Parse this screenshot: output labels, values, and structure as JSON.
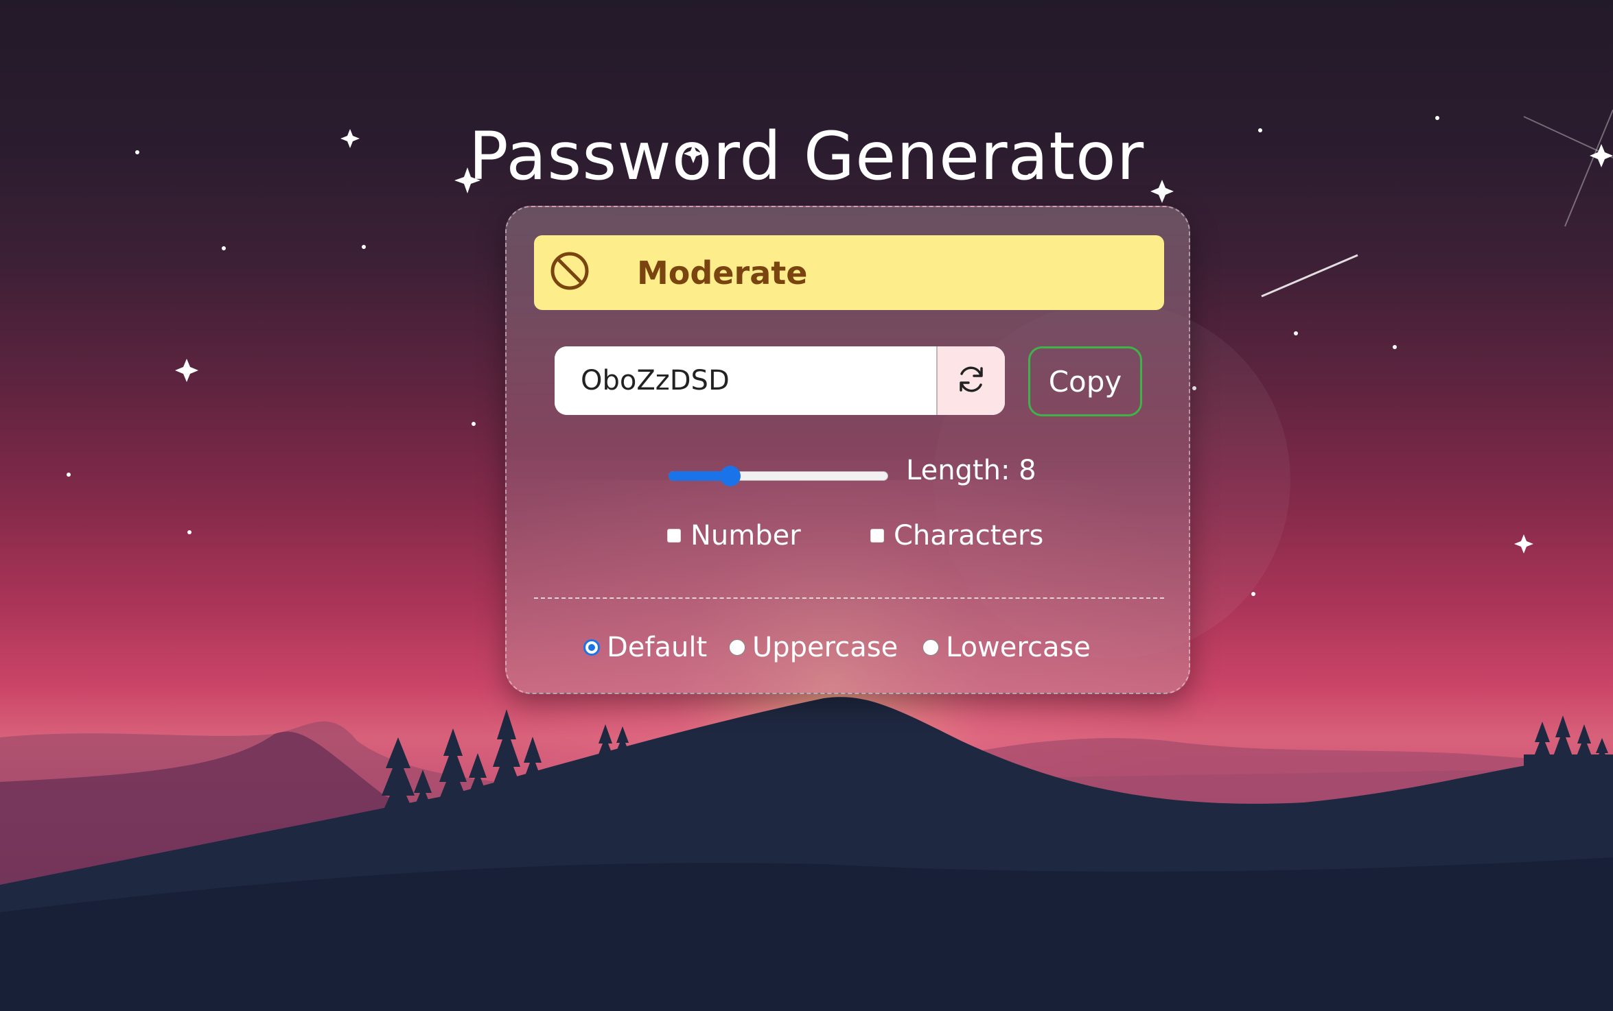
{
  "app": {
    "title": "Password Generator"
  },
  "strength": {
    "label": "Moderate",
    "icon": "prohibited-icon",
    "background": "#fdee8b",
    "text_color": "#7a4410"
  },
  "password": {
    "value": "OboZzDSD",
    "regenerate_icon": "refresh-icon"
  },
  "copy_button": {
    "label": "Copy",
    "border_color": "#3fb34a"
  },
  "length": {
    "label": "Length: 8",
    "value": 8,
    "slider_fraction": 0.28
  },
  "options": {
    "number_label": "Number",
    "number_checked": false,
    "characters_label": "Characters",
    "characters_checked": false
  },
  "case": {
    "options": [
      "Default",
      "Uppercase",
      "Lowercase"
    ],
    "selected": "Default"
  },
  "colors": {
    "accent": "#1a73e8"
  }
}
